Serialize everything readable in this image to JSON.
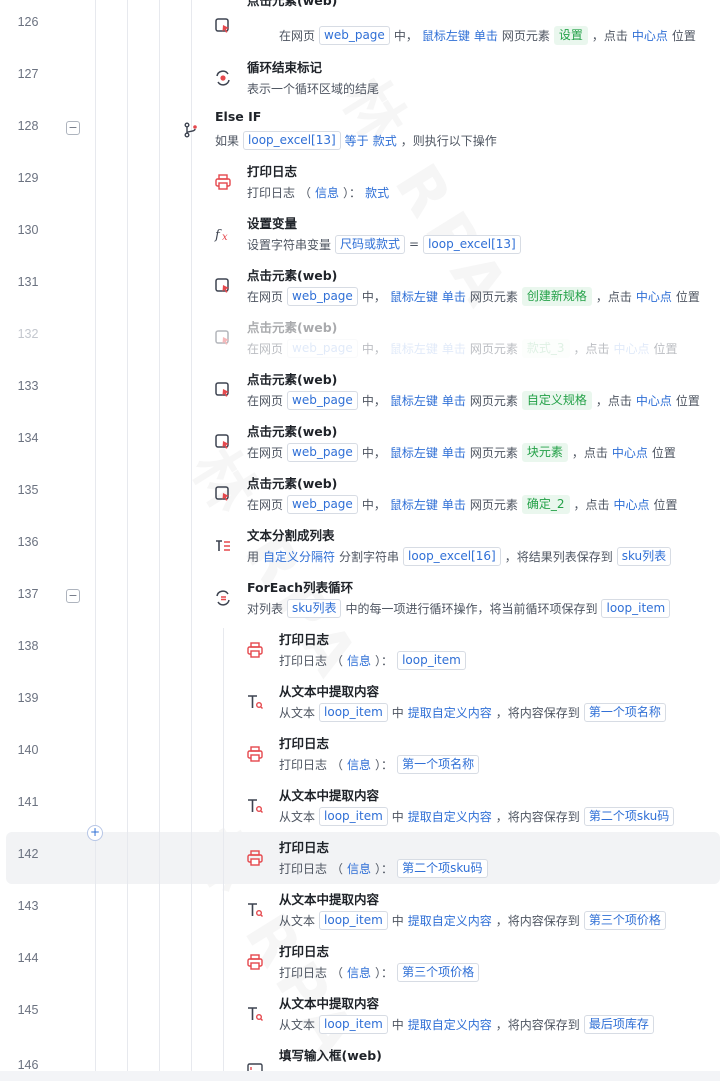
{
  "rows": [
    {
      "line": "126",
      "title": "点击元素(web)",
      "icon": "cursor-click-icon"
    },
    {
      "line": "127",
      "title": "循环结束标记",
      "desc": "表示一个循环区域的结尾",
      "icon": "loop-end-icon"
    },
    {
      "line": "128",
      "title": "Else IF",
      "icon": "branch-icon"
    },
    {
      "line": "129",
      "title": "打印日志",
      "icon": "printer-icon"
    },
    {
      "line": "130",
      "title": "设置变量",
      "icon": "function-icon"
    },
    {
      "line": "131",
      "title": "点击元素(web)",
      "icon": "cursor-click-icon"
    },
    {
      "line": "132",
      "title": "点击元素(web)",
      "icon": "cursor-click-icon"
    },
    {
      "line": "133",
      "title": "点击元素(web)",
      "icon": "cursor-click-icon"
    },
    {
      "line": "134",
      "title": "点击元素(web)",
      "icon": "cursor-click-icon"
    },
    {
      "line": "135",
      "title": "点击元素(web)",
      "icon": "cursor-click-icon"
    },
    {
      "line": "136",
      "title": "文本分割成列表",
      "icon": "text-split-icon"
    },
    {
      "line": "137",
      "title": "ForEach列表循环",
      "icon": "foreach-loop-icon"
    },
    {
      "line": "138",
      "title": "打印日志",
      "icon": "printer-icon"
    },
    {
      "line": "139",
      "title": "从文本中提取内容",
      "icon": "text-extract-icon"
    },
    {
      "line": "140",
      "title": "打印日志",
      "icon": "printer-icon"
    },
    {
      "line": "141",
      "title": "从文本中提取内容",
      "icon": "text-extract-icon"
    },
    {
      "line": "142",
      "title": "打印日志",
      "icon": "printer-icon"
    },
    {
      "line": "143",
      "title": "从文本中提取内容",
      "icon": "text-extract-icon"
    },
    {
      "line": "144",
      "title": "打印日志",
      "icon": "printer-icon"
    },
    {
      "line": "145",
      "title": "从文本中提取内容",
      "icon": "text-extract-icon"
    },
    {
      "line": "146",
      "title": "填写输入框(web)",
      "icon": "input-fill-icon"
    }
  ],
  "words": {
    "in_webpage": "在网页",
    "web_page": "web_page",
    "zhong": "中，",
    "mouse_left": "鼠标左键",
    "single_click": "单击",
    "web_element": "网页元素",
    "comma_click": "，点击",
    "center_point": "中心点",
    "position": "位置",
    "if_prefix": "如果",
    "loop_excel_13": "loop_excel[13]",
    "equals": "等于",
    "kuanshi": "款式",
    "then_exec": "，则执行以下操作",
    "print_log": "打印日志",
    "paren_open": "（",
    "info": "信息",
    "paren_close_colon": "）：",
    "set_string_var": "设置字符串变量",
    "size_or_style": "尺码或款式",
    "eq": "=",
    "use": "用",
    "custom_separator": "自定义分隔符",
    "split_string": "分割字符串",
    "loop_excel_16": "loop_excel[16]",
    "save_result_list": "，将结果列表保存到",
    "sku_list": "sku列表",
    "for_list": "对列表",
    "each_item_op": "中的每一项进行循环操作，将当前循环项保存到",
    "loop_item": "loop_item",
    "from_text": "从文本",
    "zhong_short": "中",
    "extract_custom": "提取自定义内容",
    "save_content_to": "，将内容保存到"
  },
  "elements": {
    "settings": "设置",
    "create_spec": "创建新规格",
    "style_3": "款式_3",
    "custom_spec": "自定义规格",
    "block_element": "块元素",
    "confirm_2": "确定_2"
  },
  "variables": {
    "first_name": "第一个项名称",
    "second_sku": "第二个项sku码",
    "third_price": "第三个项价格",
    "last_stock": "最后项库存"
  },
  "add_button": "+",
  "collapse_symbol": "−",
  "watermark": "林 RPA",
  "colors": {
    "accent": "#2f6fd6",
    "green_tag": "#24a148",
    "red_icon": "#e5484d"
  }
}
